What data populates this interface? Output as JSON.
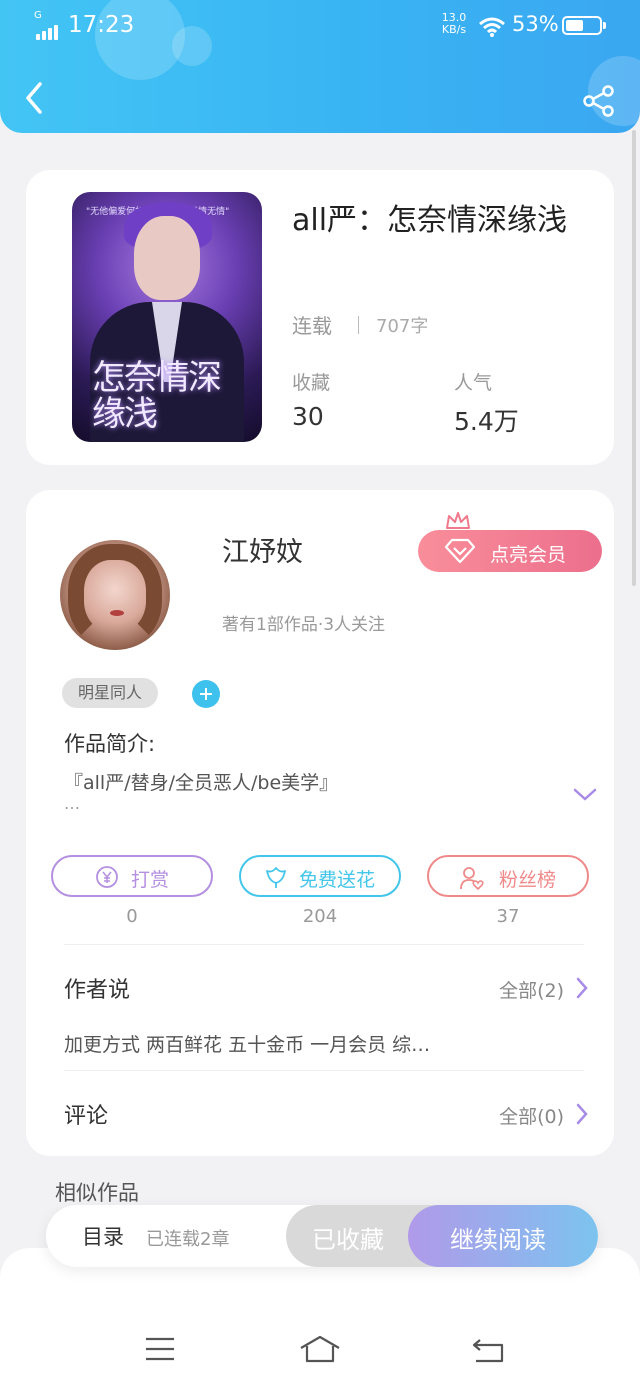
{
  "status_bar": {
    "time": "17:23",
    "network": "G",
    "speed_value": "13.0",
    "speed_unit": "KB/s",
    "battery": "53%",
    "battery_level": 0.53
  },
  "book": {
    "title": "all严：怎奈情深缘浅",
    "status": "连载",
    "word_count": "707字",
    "stats": [
      {
        "label": "收藏",
        "value": "30"
      },
      {
        "label": "人气",
        "value": "5.4万"
      }
    ],
    "cover_title": "怎奈情深缘浅",
    "cover_tagline": "\"无他偏爱何如何时，权势无情无情\""
  },
  "author": {
    "name": "江妤妏",
    "meta": "著有1部作品·3人关注",
    "vip_button": "点亮会员",
    "tag": "明星同人"
  },
  "intro": {
    "title": "作品简介:",
    "text": "『all严/替身/全员恶人/be美学』",
    "more": "…"
  },
  "actions": [
    {
      "label": "打赏",
      "count": "0",
      "color": "#b58fe0"
    },
    {
      "label": "免费送花",
      "count": "204",
      "color": "#43c6ea"
    },
    {
      "label": "粉丝榜",
      "count": "37",
      "color": "#f08a8a"
    }
  ],
  "author_says": {
    "title": "作者说",
    "link": "全部(2)",
    "text": "加更方式 两百鲜花 五十金币 一月会员 综…"
  },
  "comments": {
    "title": "评论",
    "link": "全部(0)"
  },
  "similar": {
    "title": "相似作品"
  },
  "bottom_bar": {
    "toc": "目录",
    "toc_sub": "已连载2章",
    "favorited": "已收藏",
    "continue": "继续阅读"
  },
  "colors": {
    "header": "#3ab8f3",
    "accent_purple": "#a78be6",
    "vip_pink": "#ef7690"
  }
}
